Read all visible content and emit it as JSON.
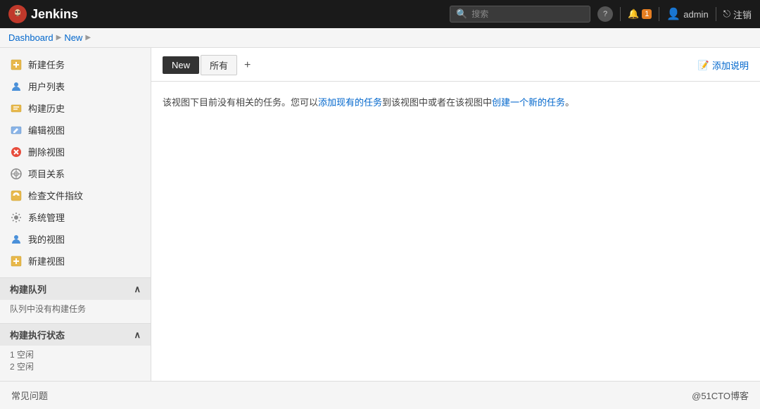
{
  "header": {
    "logo_text": "Jenkins",
    "logo_icon": "🤖",
    "search_placeholder": "搜索",
    "help_icon": "?",
    "notifications_icon": "🔔",
    "notification_badge": "1",
    "user_icon": "👤",
    "user_name": "admin",
    "logout_icon": "⎋",
    "logout_label": "注销"
  },
  "breadcrumb": {
    "items": [
      {
        "label": "Dashboard",
        "link": true
      },
      {
        "label": "New",
        "link": true
      }
    ]
  },
  "sidebar": {
    "items": [
      {
        "id": "new-task",
        "icon": "📋",
        "label": "新建任务"
      },
      {
        "id": "user-list",
        "icon": "👥",
        "label": "用户列表"
      },
      {
        "id": "build-history",
        "icon": "🔄",
        "label": "构建历史"
      },
      {
        "id": "edit-view",
        "icon": "✏️",
        "label": "编辑视图"
      },
      {
        "id": "delete-view",
        "icon": "🚫",
        "label": "删除视图"
      },
      {
        "id": "project-relation",
        "icon": "🔍",
        "label": "项目关系"
      },
      {
        "id": "check-fingerprint",
        "icon": "🔐",
        "label": "检查文件指纹"
      },
      {
        "id": "system-manage",
        "icon": "⚙️",
        "label": "系统管理"
      },
      {
        "id": "my-view",
        "icon": "👤",
        "label": "我的视图"
      },
      {
        "id": "new-view",
        "icon": "📋",
        "label": "新建视图"
      }
    ],
    "sections": [
      {
        "id": "build-queue",
        "title": "构建队列",
        "empty_text": "队列中没有构建任务"
      },
      {
        "id": "build-exec",
        "title": "构建执行状态",
        "items": [
          "1 空闲",
          "2 空闲"
        ]
      }
    ]
  },
  "tabs": {
    "items": [
      {
        "id": "new-tab",
        "label": "New",
        "active": true
      },
      {
        "id": "all-tab",
        "label": "所有",
        "active": false
      }
    ],
    "add_icon": "+"
  },
  "add_description": {
    "icon": "📝",
    "label": "添加说明"
  },
  "main_content": {
    "description_text": "该视图下目前没有相关的任务。您可以",
    "link1_text": "添加现有的任务",
    "middle_text": "到该视图中或者在该视图中",
    "link2_text": "创建一个新的任务",
    "end_text": "。"
  },
  "footer": {
    "left_text": "常见问题",
    "right_text": "@51CTO博客"
  }
}
